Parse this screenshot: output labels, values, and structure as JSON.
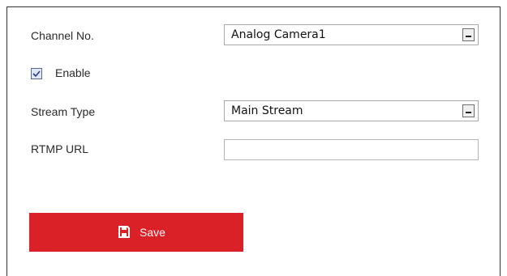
{
  "form": {
    "channel_label": "Channel No.",
    "channel_value": "Analog Camera1",
    "enable_label": "Enable",
    "enable_checked": true,
    "stream_type_label": "Stream Type",
    "stream_type_value": "Main Stream",
    "rtmp_url_label": "RTMP URL",
    "rtmp_url_value": ""
  },
  "actions": {
    "save_label": "Save"
  },
  "colors": {
    "save_button_bg": "#d92127",
    "save_button_text": "#ffffff"
  },
  "icons": {
    "save": "floppy-disk-icon",
    "dropdown": "chevron-down-icon",
    "checkbox": "checkmark-icon"
  }
}
